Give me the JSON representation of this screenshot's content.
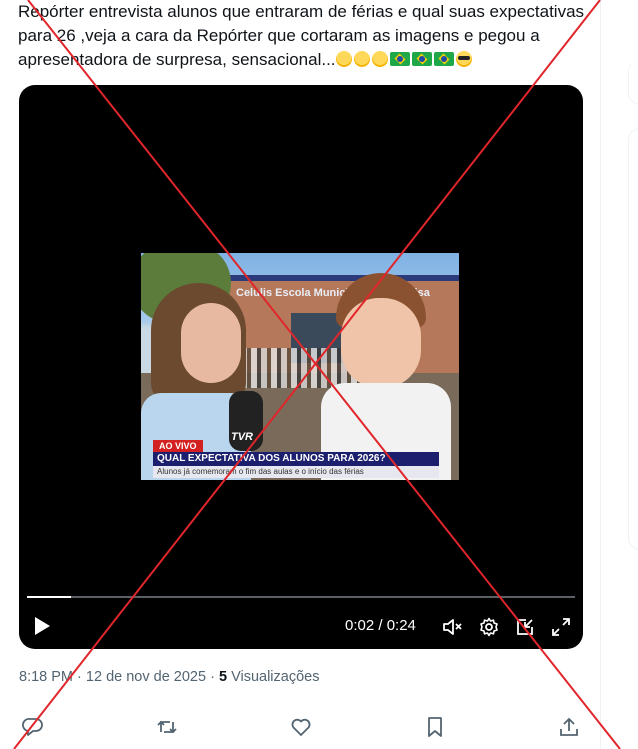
{
  "tweet": {
    "text": "Repórter entrevista alunos que entraram de férias e qual suas expectativas para 26 ,veja a cara da Repórter que cortaram as imagens e pegou a apresentadora de surpresa, sensacional...",
    "emojis": [
      "rolling-laughing-emoji",
      "joy-emoji",
      "rolling-laughing-emoji",
      "brazil-flag-emoji",
      "brazil-flag-emoji",
      "brazil-flag-emoji",
      "sunglasses-emoji"
    ]
  },
  "video": {
    "thumbnail": {
      "school_sign": "Escola Municip",
      "school_sign_left": "Celulis",
      "school_sign_right": "Elisa",
      "live_tag": "AO VIVO",
      "channel_logo": "TVR",
      "headline": "QUAL EXPECTATIVA DOS ALUNOS PARA 2026?",
      "subline": "Alunos já comemoram o fim das aulas e o início das férias"
    },
    "progress_fraction": 0.08,
    "time_display": "0:02 / 0:24",
    "controls": [
      "play-icon",
      "mute-icon",
      "settings-icon",
      "picture-in-picture-icon",
      "fullscreen-icon"
    ]
  },
  "meta": {
    "time": "8:18 PM",
    "separator": "·",
    "date": "12 de nov de 2025",
    "views_count": "5",
    "views_label": "Visualizações"
  },
  "actions": [
    "reply-icon",
    "retweet-icon",
    "like-icon",
    "bookmark-icon",
    "share-icon"
  ],
  "colors": {
    "text": "#0f1419",
    "muted": "#536471",
    "x_overlay": "#e0262b",
    "video_bg": "#000000"
  }
}
